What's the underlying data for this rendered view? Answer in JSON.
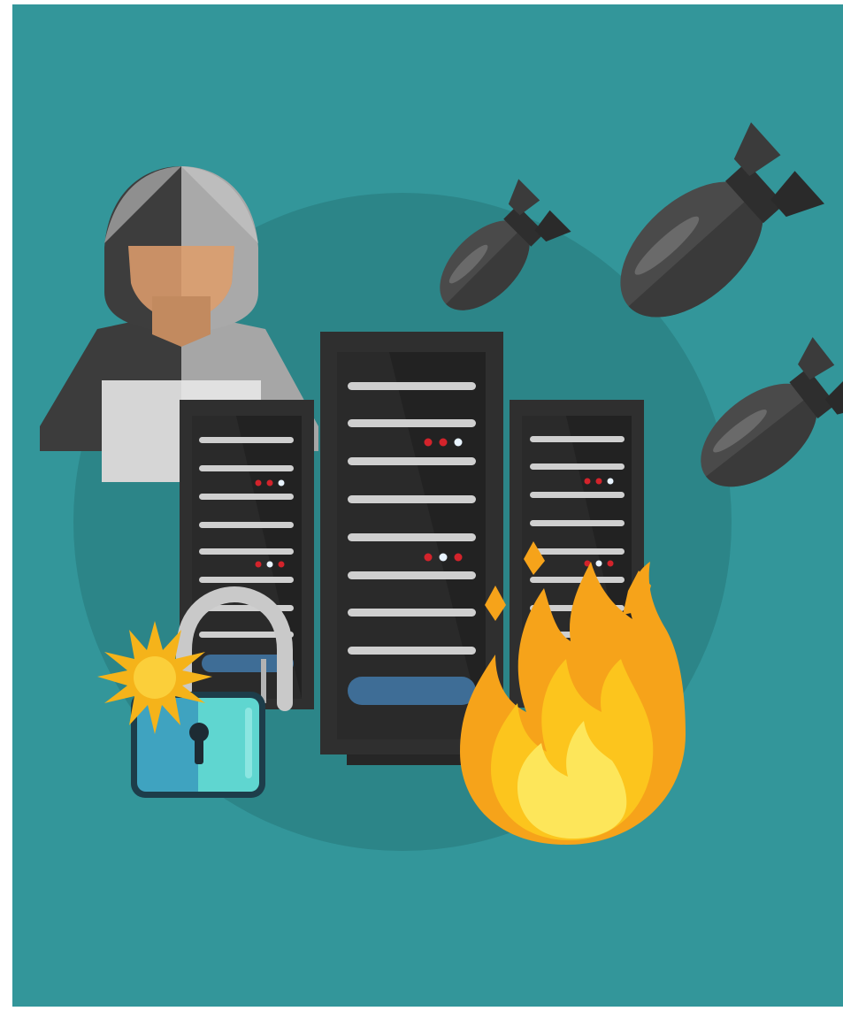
{
  "scene": {
    "subject": "cyber-attack-on-server-racks",
    "elements": [
      "hooded-hacker",
      "laptop",
      "server-racks",
      "bombs",
      "broken-padlock",
      "fire"
    ]
  },
  "colors": {
    "background": "#33969a",
    "backdrop_circle": "#2c8588",
    "frame": "#ffffff",
    "rack_body": "#2f2f2f",
    "rack_panel": "#242424",
    "rack_slot": "#cfcfcf",
    "led_red": "#d3232b",
    "led_white": "#e8f3ff",
    "rack_button": "#3e6d96",
    "hood_light": "#a5a5a5",
    "hood_dark": "#3c3c3c",
    "skin": "#c99066",
    "laptop": "#e0e0e0",
    "bomb": "#4a4a4a",
    "padlock_left": "#3fa3c0",
    "padlock_right": "#5fd6d0",
    "shackle": "#c9c9c9",
    "spark": "#f5b31a",
    "fire_outer": "#f6a31a",
    "fire_mid": "#fcc51d",
    "fire_inner": "#fde65a"
  }
}
